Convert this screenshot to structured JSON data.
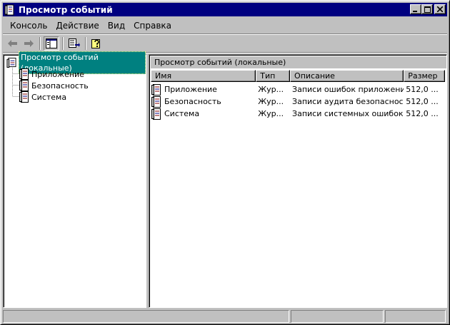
{
  "window": {
    "title": "Просмотр событий"
  },
  "menu": [
    {
      "label": "Консоль"
    },
    {
      "label": "Действие"
    },
    {
      "label": "Вид"
    },
    {
      "label": "Справка"
    }
  ],
  "toolbar": {
    "buttons": [
      "back-arrow-icon",
      "forward-arrow-icon",
      "show-hide-tree-icon",
      "export-list-icon",
      "help-icon"
    ]
  },
  "tree": {
    "root_label": "Просмотр событий (локальные)",
    "children": [
      {
        "label": "Приложение"
      },
      {
        "label": "Безопасность"
      },
      {
        "label": "Система"
      }
    ]
  },
  "list": {
    "header": "Просмотр событий (локальные)",
    "columns": [
      "Имя",
      "Тип",
      "Описание",
      "Размер"
    ],
    "rows": [
      {
        "name": "Приложение",
        "type": "Жур...",
        "description": "Записи ошибок приложений",
        "size": "512,0 ..."
      },
      {
        "name": "Безопасность",
        "type": "Жур...",
        "description": "Записи аудита безопасности",
        "size": "512,0 ..."
      },
      {
        "name": "Система",
        "type": "Жур...",
        "description": "Записи системных ошибок",
        "size": "512,0 ..."
      }
    ]
  },
  "colors": {
    "titlebar": "#000080",
    "selection": "#008080",
    "face": "#c0c0c0"
  }
}
